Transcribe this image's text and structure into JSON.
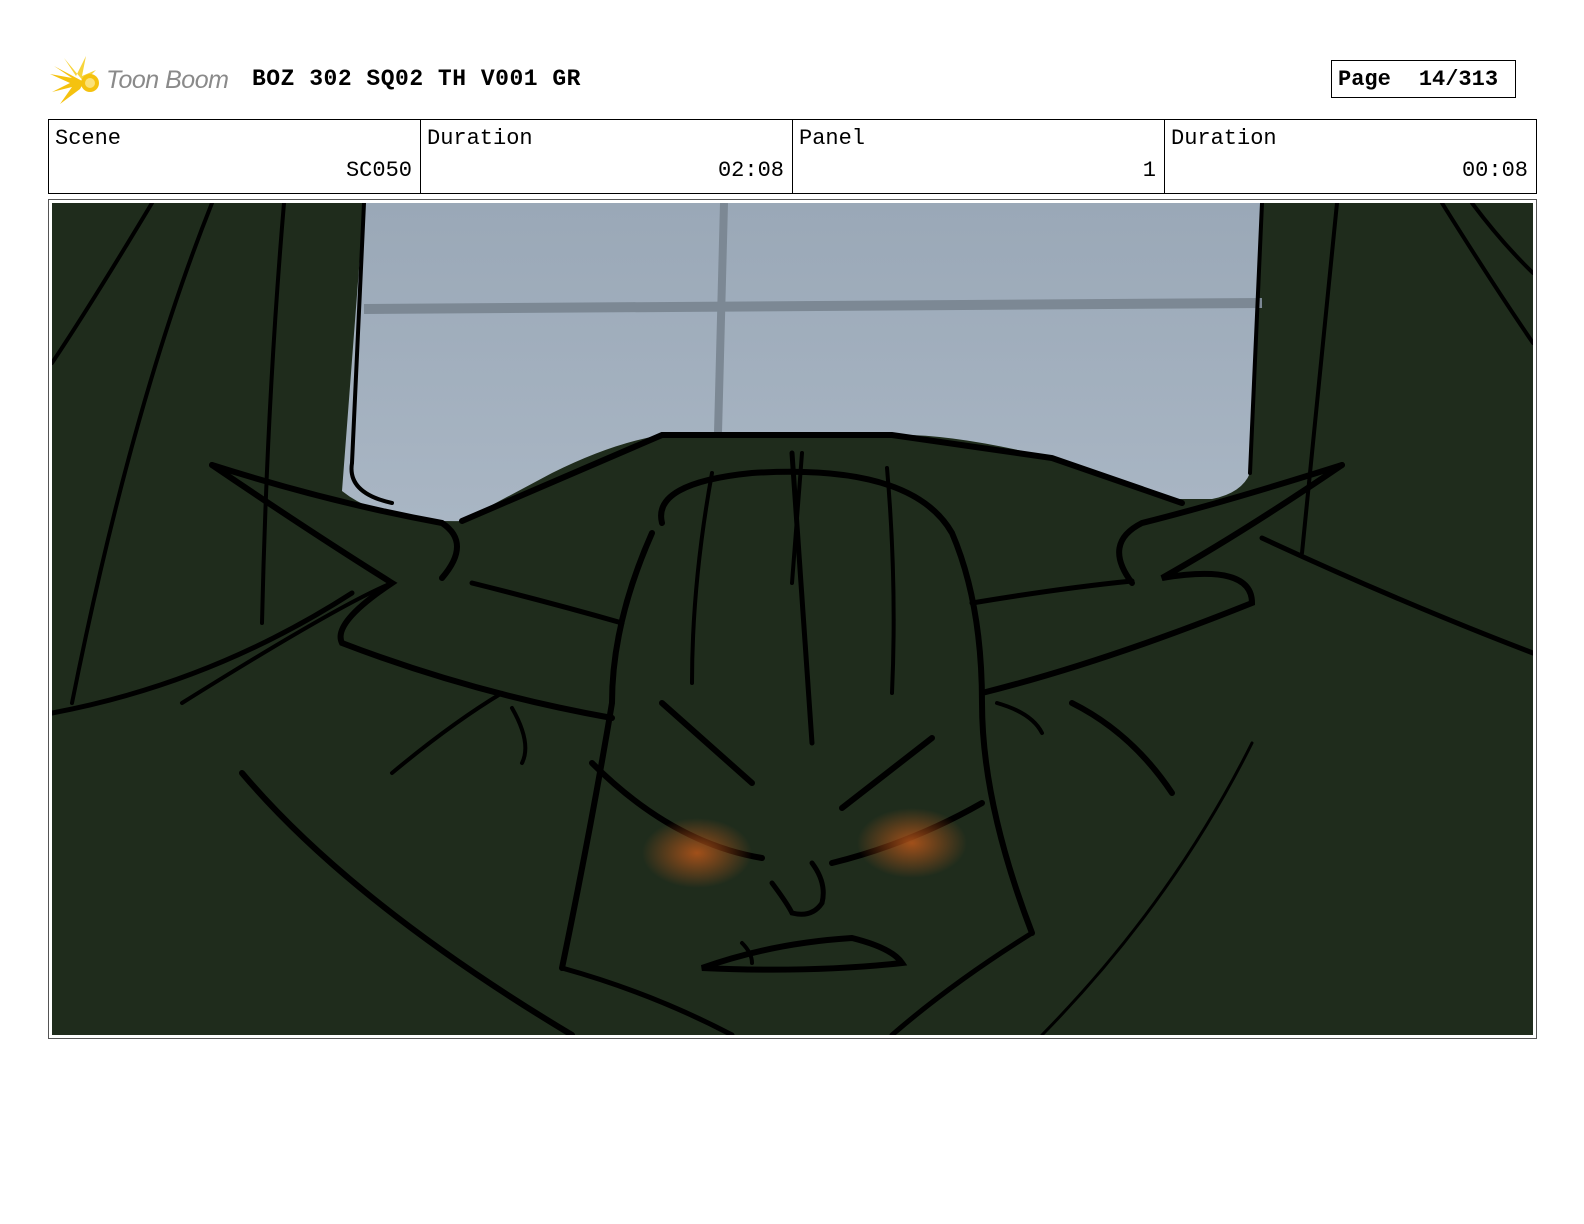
{
  "header": {
    "logo_text": "Toon Boom",
    "title": "BOZ 302 SQ02 TH V001 GR",
    "page_label": "Page",
    "page_value": "14/313"
  },
  "info": {
    "scene_label": "Scene",
    "scene_value": "SC050",
    "scene_duration_label": "Duration",
    "scene_duration_value": "02:08",
    "panel_label": "Panel",
    "panel_value": "1",
    "panel_duration_label": "Duration",
    "panel_duration_value": "00:08"
  },
  "colors": {
    "logo_yellow": "#f5c20f",
    "sky": "#a9b6c4",
    "dark_green": "#1f2c1c",
    "eye_glow": "#b8561a"
  }
}
